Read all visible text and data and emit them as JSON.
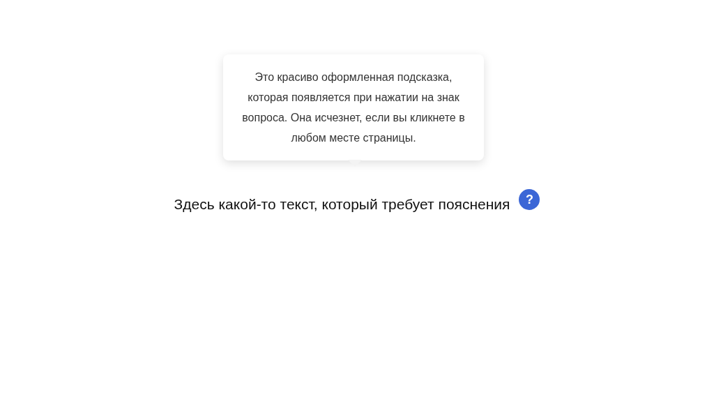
{
  "tooltip": {
    "text": "Это красиво оформленная подсказка, которая появляется при нажатии на знак вопроса. Она исчезнет, если вы кликнете в любом месте страницы."
  },
  "text": "Здесь какой-то текст, который требует пояснения",
  "help_button": {
    "label": "?"
  }
}
